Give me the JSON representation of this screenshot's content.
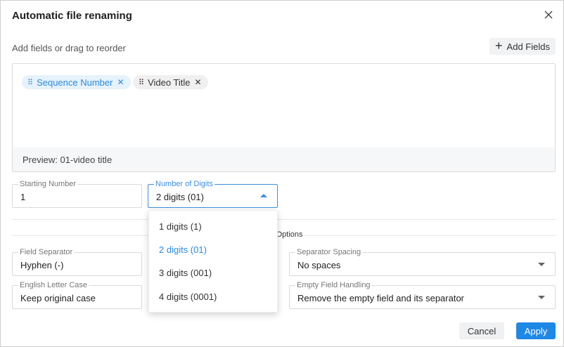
{
  "dialog": {
    "title": "Automatic file renaming",
    "close_icon": "close-icon",
    "subtitle": "Add fields or drag to reorder",
    "add_fields_label": "Add Fields"
  },
  "chips": [
    {
      "label": "Sequence Number",
      "active": true
    },
    {
      "label": "Video Title",
      "active": false
    }
  ],
  "preview": "Preview: 01-video title",
  "starting_number": {
    "label": "Starting Number",
    "value": "1"
  },
  "number_of_digits": {
    "label": "Number of Digits",
    "value": "2 digits (01)",
    "options": [
      "1 digits (1)",
      "2 digits (01)",
      "3 digits (001)",
      "4 digits (0001)"
    ],
    "selected_index": 1
  },
  "section_label": "al Options",
  "field_separator": {
    "label": "Field Separator",
    "value": "Hyphen (-)"
  },
  "separator_spacing": {
    "label": "Separator Spacing",
    "value": "No spaces"
  },
  "english_letter_case": {
    "label": "English Letter Case",
    "value": "Keep original case"
  },
  "empty_field_handling": {
    "label": "Empty Field Handling",
    "value": "Remove the empty field and its separator"
  },
  "buttons": {
    "cancel": "Cancel",
    "apply": "Apply"
  },
  "colors": {
    "accent": "#1e88e5",
    "chip_active_bg": "#e6f2fc"
  }
}
